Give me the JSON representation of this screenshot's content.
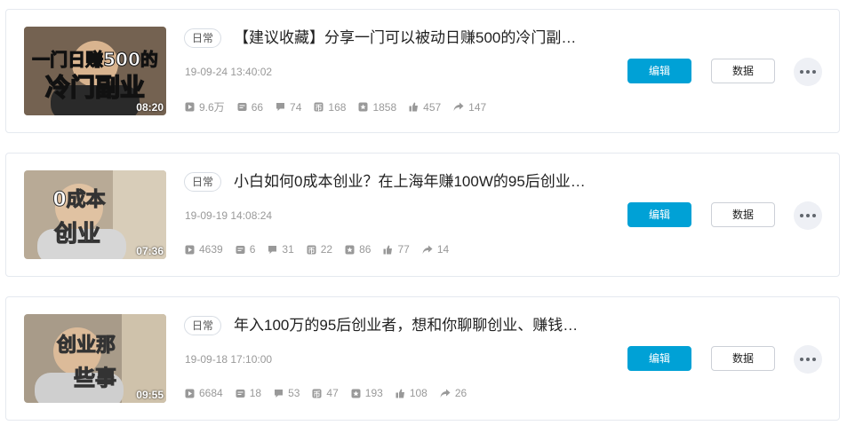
{
  "videos": [
    {
      "category": "日常",
      "title": "【建议收藏】分享一门可以被动日赚500的冷门副…",
      "time": "19-09-24 13:40:02",
      "duration": "08:20",
      "thumb_text_top": "一门日赚500的",
      "thumb_text_bottom": "冷门副业",
      "stats": {
        "plays": "9.6万",
        "danmaku": "66",
        "comments": "74",
        "coins": "168",
        "favorites": "1858",
        "likes": "457",
        "shares": "147"
      },
      "edit_label": "编辑",
      "data_label": "数据"
    },
    {
      "category": "日常",
      "title": "小白如何0成本创业？在上海年赚100W的95后创业…",
      "time": "19-09-19 14:08:24",
      "duration": "07:36",
      "thumb_text_top": "0成本",
      "thumb_text_bottom": "创业",
      "stats": {
        "plays": "4639",
        "danmaku": "6",
        "comments": "31",
        "coins": "22",
        "favorites": "86",
        "likes": "77",
        "shares": "14"
      },
      "edit_label": "编辑",
      "data_label": "数据"
    },
    {
      "category": "日常",
      "title": "年入100万的95后创业者，想和你聊聊创业、赚钱…",
      "time": "19-09-18 17:10:00",
      "duration": "09:55",
      "thumb_text_top": "创业那",
      "thumb_text_bottom": "些事",
      "stats": {
        "plays": "6684",
        "danmaku": "18",
        "comments": "53",
        "coins": "47",
        "favorites": "193",
        "likes": "108",
        "shares": "26"
      },
      "edit_label": "编辑",
      "data_label": "数据"
    }
  ],
  "colors": {
    "accent": "#00a1d6",
    "muted_text": "#999999",
    "border": "#e5e9ef"
  },
  "icons": {
    "plays": "play-icon",
    "danmaku": "danmaku-icon",
    "comments": "comment-icon",
    "coins": "coin-icon",
    "favorites": "favorite-icon",
    "likes": "like-icon",
    "shares": "share-icon",
    "more": "more-icon"
  }
}
